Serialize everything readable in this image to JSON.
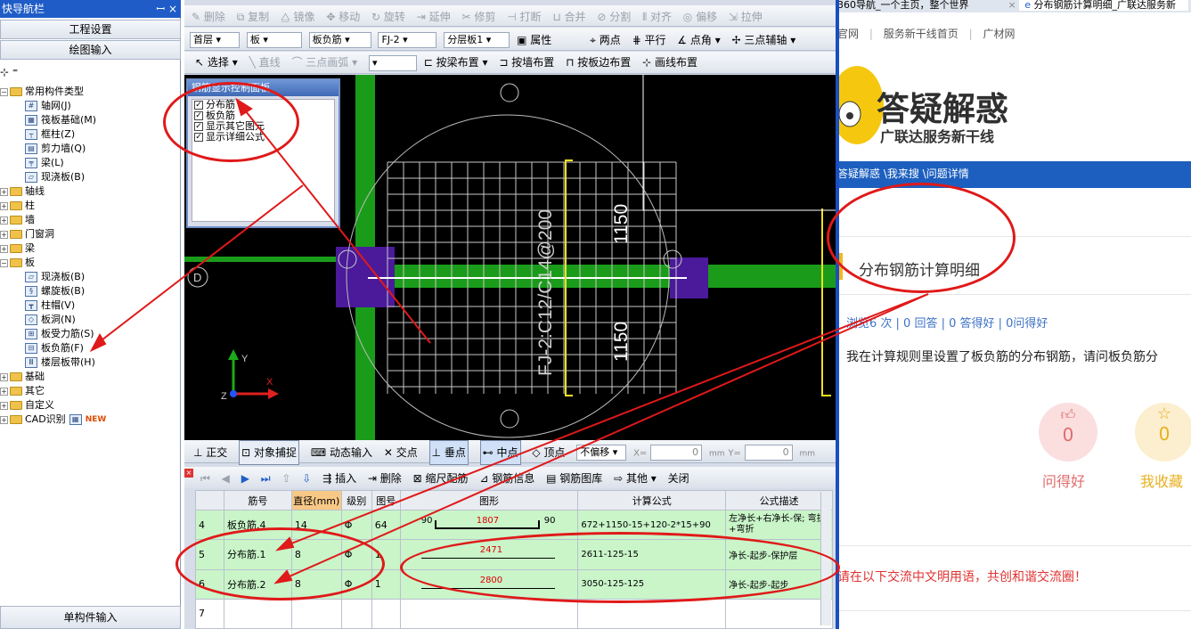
{
  "left_panel": {
    "title": "快导航栏",
    "title_controls": "ꟷ ×",
    "btn_settings": "工程设置",
    "btn_draw": "绘图输入",
    "btn_single": "单构件输入",
    "tree": {
      "common": "常用构件类型",
      "items_common": [
        "轴网(J)",
        "筏板基础(M)",
        "框柱(Z)",
        "剪力墙(Q)",
        "梁(L)",
        "现浇板(B)"
      ],
      "axis": "轴线",
      "column": "柱",
      "wall": "墙",
      "opening": "门窗洞",
      "beam": "梁",
      "slab": "板",
      "items_slab": [
        "现浇板(B)",
        "螺旋板(B)",
        "柱帽(V)",
        "板洞(N)",
        "板受力筋(S)",
        "板负筋(F)",
        "楼层板带(H)"
      ],
      "foundation": "基础",
      "other": "其它",
      "custom": "自定义",
      "cad": "CAD识别",
      "new_badge": "NEW"
    }
  },
  "toolbar1": [
    "删除",
    "复制",
    "镜像",
    "移动",
    "旋转",
    "延伸",
    "修剪",
    "打断",
    "合并",
    "分割",
    "对齐",
    "偏移",
    "拉伸"
  ],
  "toolbar2": {
    "floor": "首层",
    "type": "板",
    "member": "板负筋",
    "name": "FJ-2",
    "layer": "分层板1",
    "attr": "属性",
    "two_point": "两点",
    "parallel": "平行",
    "point_angle": "点角",
    "three_aux": "三点辅轴"
  },
  "toolbar3": {
    "select": "选择",
    "line": "直线",
    "arc": "三点画弧",
    "by_beam": "按梁布置",
    "by_wall": "按墙布置",
    "by_slab_edge": "按板边布置",
    "draw_line": "画线布置"
  },
  "display_panel": {
    "title": "钢筋显示控制面板",
    "options": [
      "分布筋",
      "板负筋",
      "显示其它图元",
      "显示详细公式"
    ]
  },
  "canvas": {
    "rebar_label": "FJ-2:C12/C14@200",
    "dim_top": "1150",
    "dim_bottom": "1150",
    "axis_label": "D",
    "y_label": "Y",
    "x_label": "X",
    "z_label": "Z"
  },
  "snap_bar": {
    "ortho": "正交",
    "obj_snap": "对象捕捉",
    "dyn_input": "动态输入",
    "intersect": "交点",
    "perp": "垂点",
    "mid": "中点",
    "vertex": "顶点",
    "offset": "不偏移",
    "x_label": "X=",
    "x_val": "0",
    "y_label": "Y=",
    "y_val": "0",
    "unit": "mm"
  },
  "grid_toolbar": {
    "insert": "插入",
    "delete": "删除",
    "scale": "缩尺配筋",
    "info": "钢筋信息",
    "library": "钢筋图库",
    "other": "其他",
    "close": "关闭"
  },
  "table": {
    "headers": [
      "",
      "筋号",
      "直径(mm)",
      "级别",
      "图号",
      "图形",
      "计算公式",
      "公式描述"
    ],
    "rows": [
      {
        "idx": "4",
        "name": "板负筋.4",
        "dia": "14",
        "grade": "Φ",
        "fig": "64",
        "shape_left": "90",
        "shape_mid": "1807",
        "shape_right": "90",
        "formula": "672+1150-15+120-2*15+90",
        "desc": "左净长+右净长-保; 弯折+弯折"
      },
      {
        "idx": "5",
        "name": "分布筋.1",
        "dia": "8",
        "grade": "Φ",
        "fig": "1",
        "shape_mid": "2471",
        "formula": "2611-125-15",
        "desc": "净长-起步-保护层"
      },
      {
        "idx": "6",
        "name": "分布筋.2",
        "dia": "8",
        "grade": "Φ",
        "fig": "1",
        "shape_mid": "2800",
        "formula": "3050-125-125",
        "desc": "净长-起步-起步"
      },
      {
        "idx": "7"
      }
    ]
  },
  "browser": {
    "tab1": "360导航_一个主页，整个世界",
    "tab2": "分布钢筋计算明细_广联达服务新",
    "nav_links": [
      "官网",
      "服务新干线首页",
      "广材网"
    ],
    "logo_big": "答疑解惑",
    "logo_sub": "广联达服务新干线",
    "breadcrumb": "答疑解惑 \\我来搜 \\问题详情",
    "question_title": "分布钢筋计算明细",
    "stats": "浏览6 次 | 0 回答 | 0 答得好 | 0问得好",
    "question_text": "我在计算规则里设置了板负筋的分布钢筋，请问板负筋分",
    "like_count": "0",
    "like_label": "问得好",
    "fav_count": "0",
    "fav_label": "我收藏",
    "footer_hint": "请在以下交流中文明用语，共创和谐交流圈！"
  }
}
